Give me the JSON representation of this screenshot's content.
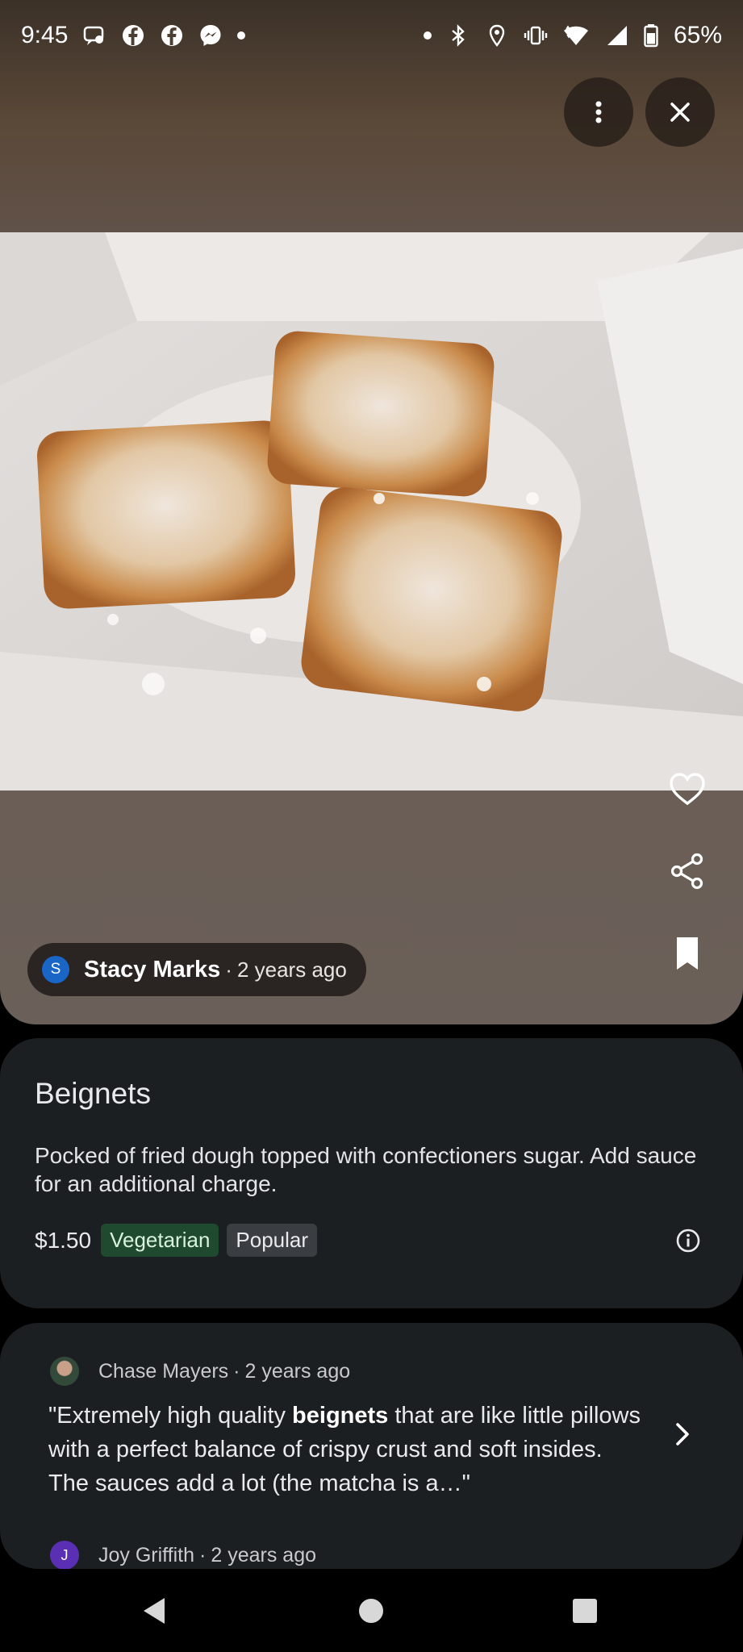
{
  "status_bar": {
    "time": "9:45",
    "battery": "65%",
    "left_icons": [
      "messages-icon",
      "facebook-icon",
      "facebook-icon",
      "messenger-icon",
      "dot-icon"
    ],
    "right_icons": [
      "dot-icon",
      "bluetooth-icon",
      "location-icon",
      "vibrate-icon",
      "wifi-icon",
      "signal-icon",
      "battery-icon"
    ]
  },
  "photo": {
    "author_initial": "S",
    "author_name": "Stacy Marks",
    "separator": "·",
    "time_ago": "2 years ago"
  },
  "dish": {
    "title": "Beignets",
    "description": "Pocked of fried dough topped with confectioners sugar. Add sauce for an additional charge.",
    "price": "$1.50",
    "tags": [
      "Vegetarian",
      "Popular"
    ]
  },
  "reviews": [
    {
      "name": "Chase Mayers",
      "separator": "·",
      "time_ago": "2 years ago",
      "text_pre": "\"Extremely high quality ",
      "text_bold": "beignets",
      "text_post": " that are like little pillows with a perfect balance of crispy crust and soft insides. The sauces add a lot (the matcha is a…\""
    },
    {
      "initial": "J",
      "name": "Joy Griffith",
      "separator": "·",
      "time_ago": "2 years ago"
    }
  ],
  "colors": {
    "card_bg": "#1c1f22",
    "veg_tag_bg": "#1f4a2f",
    "author_avatar": "#1966c7",
    "joy_avatar": "#5b2fb3"
  }
}
